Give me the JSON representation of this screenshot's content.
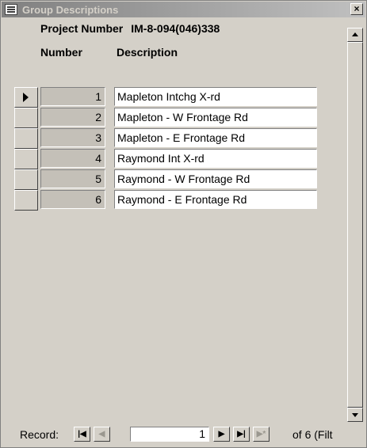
{
  "window": {
    "title": "Group Descriptions",
    "close_label": "×"
  },
  "form": {
    "project_label": "Project Number",
    "project_number": "IM-8-094(046)338",
    "col_number_header": "Number",
    "col_description_header": "Description"
  },
  "rows": [
    {
      "number": "1",
      "description": "Mapleton Intchg X-rd"
    },
    {
      "number": "2",
      "description": "Mapleton - W Frontage Rd"
    },
    {
      "number": "3",
      "description": "Mapleton - E Frontage Rd"
    },
    {
      "number": "4",
      "description": "Raymond Int X-rd"
    },
    {
      "number": "5",
      "description": "Raymond - W Frontage Rd"
    },
    {
      "number": "6",
      "description": "Raymond - E Frontage Rd"
    }
  ],
  "navigation": {
    "record_label": "Record:",
    "first_icon": "first-record-icon",
    "prev_icon": "previous-record-icon",
    "current_record": "1",
    "next_icon": "next-record-icon",
    "last_icon": "last-record-icon",
    "new_icon": "new-record-icon",
    "of_text": "of  6 (Filt"
  }
}
